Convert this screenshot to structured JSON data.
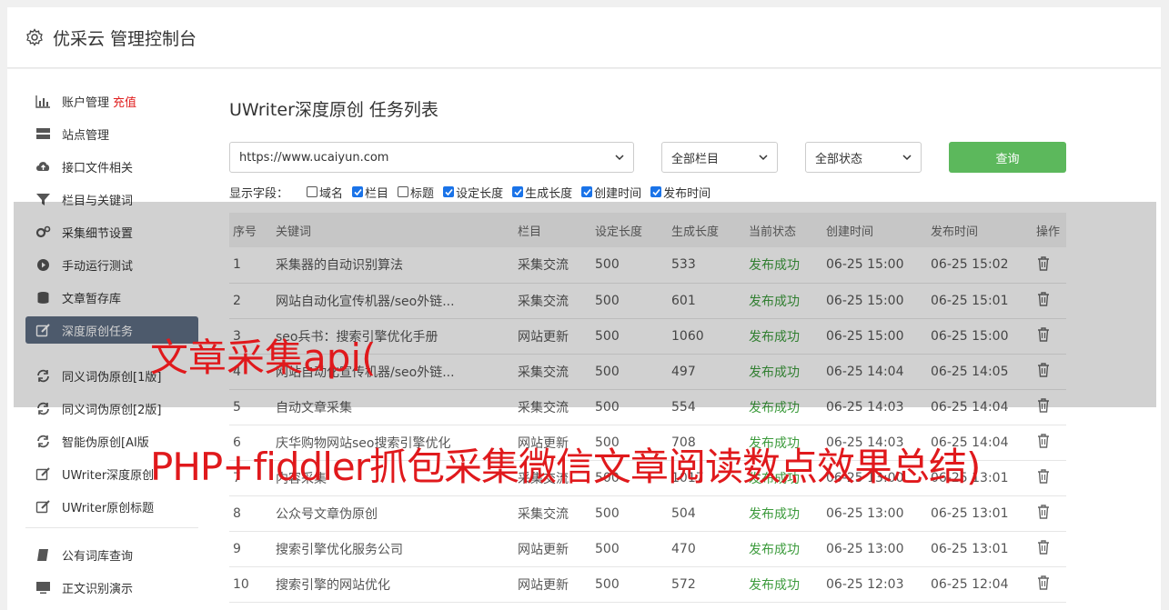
{
  "header": {
    "title": "优采云 管理控制台",
    "icon": "gear-icon"
  },
  "sidebar": {
    "group1": [
      {
        "label": "账户管理",
        "badge": "充值",
        "icon": "bar-chart-icon"
      },
      {
        "label": "站点管理",
        "icon": "server-icon"
      },
      {
        "label": "接口文件相关",
        "icon": "cloud-upload-icon"
      },
      {
        "label": "栏目与关键词",
        "icon": "filter-icon"
      },
      {
        "label": "采集细节设置",
        "icon": "gears-icon"
      },
      {
        "label": "手动运行测试",
        "icon": "play-circle-icon"
      },
      {
        "label": "文章暂存库",
        "icon": "database-icon"
      },
      {
        "label": "深度原创任务",
        "icon": "edit-icon",
        "active": true
      }
    ],
    "group2": [
      {
        "label": "同义词伪原创[1版]",
        "icon": "refresh-icon"
      },
      {
        "label": "同义词伪原创[2版]",
        "icon": "refresh-icon"
      },
      {
        "label": "智能伪原创[AI版",
        "icon": "refresh-icon"
      },
      {
        "label": "UWriter深度原创",
        "icon": "edit-icon"
      },
      {
        "label": "UWriter原创标题",
        "icon": "edit-icon"
      }
    ],
    "group3": [
      {
        "label": "公有词库查询",
        "icon": "book-icon"
      },
      {
        "label": "正文识别演示",
        "icon": "monitor-icon"
      }
    ]
  },
  "main": {
    "title": "UWriter深度原创 任务列表",
    "site_select": "https://www.ucaiyun.com",
    "column_select": "全部栏目",
    "status_select": "全部状态",
    "query_button": "查询",
    "fields_label": "显示字段：",
    "fields": [
      {
        "label": "域名",
        "checked": false
      },
      {
        "label": "栏目",
        "checked": true
      },
      {
        "label": "标题",
        "checked": false
      },
      {
        "label": "设定长度",
        "checked": true
      },
      {
        "label": "生成长度",
        "checked": true
      },
      {
        "label": "创建时间",
        "checked": true
      },
      {
        "label": "发布时间",
        "checked": true
      }
    ],
    "columns": [
      "序号",
      "关键词",
      "栏目",
      "设定长度",
      "生成长度",
      "当前状态",
      "创建时间",
      "发布时间",
      "操作"
    ],
    "rows": [
      [
        "1",
        "采集器的自动识别算法",
        "采集交流",
        "500",
        "533",
        "发布成功",
        "06-25 15:00",
        "06-25 15:02"
      ],
      [
        "2",
        "网站自动化宣传机器/seo外链...",
        "采集交流",
        "500",
        "601",
        "发布成功",
        "06-25 15:00",
        "06-25 15:01"
      ],
      [
        "3",
        "seo兵书：搜索引擎优化手册",
        "网站更新",
        "500",
        "1060",
        "发布成功",
        "06-25 15:00",
        "06-25 15:00"
      ],
      [
        "4",
        "网站自动化宣传机器/seo外链...",
        "采集交流",
        "500",
        "497",
        "发布成功",
        "06-25 14:04",
        "06-25 14:05"
      ],
      [
        "5",
        "自动文章采集",
        "采集交流",
        "500",
        "554",
        "发布成功",
        "06-25 14:03",
        "06-25 14:04"
      ],
      [
        "6",
        "庆华购物网站seo搜索引擎优化",
        "网站更新",
        "500",
        "708",
        "发布成功",
        "06-25 14:03",
        "06-25 14:04"
      ],
      [
        "7",
        "内容采集",
        "采集交流",
        "500",
        "1017",
        "发布成功",
        "06-25 13:00",
        "06-25 13:01"
      ],
      [
        "8",
        "公众号文章伪原创",
        "采集交流",
        "500",
        "504",
        "发布成功",
        "06-25 13:00",
        "06-25 13:01"
      ],
      [
        "9",
        "搜索引擎优化服务公司",
        "网站更新",
        "500",
        "470",
        "发布成功",
        "06-25 13:00",
        "06-25 13:01"
      ],
      [
        "10",
        "搜索引擎的网站优化",
        "网站更新",
        "500",
        "572",
        "发布成功",
        "06-25 12:03",
        "06-25 12:04"
      ]
    ]
  },
  "watermark": {
    "line1": "文章采集api(",
    "line2": "PHP+fiddler抓包采集微信文章阅读数点效果总结)"
  }
}
